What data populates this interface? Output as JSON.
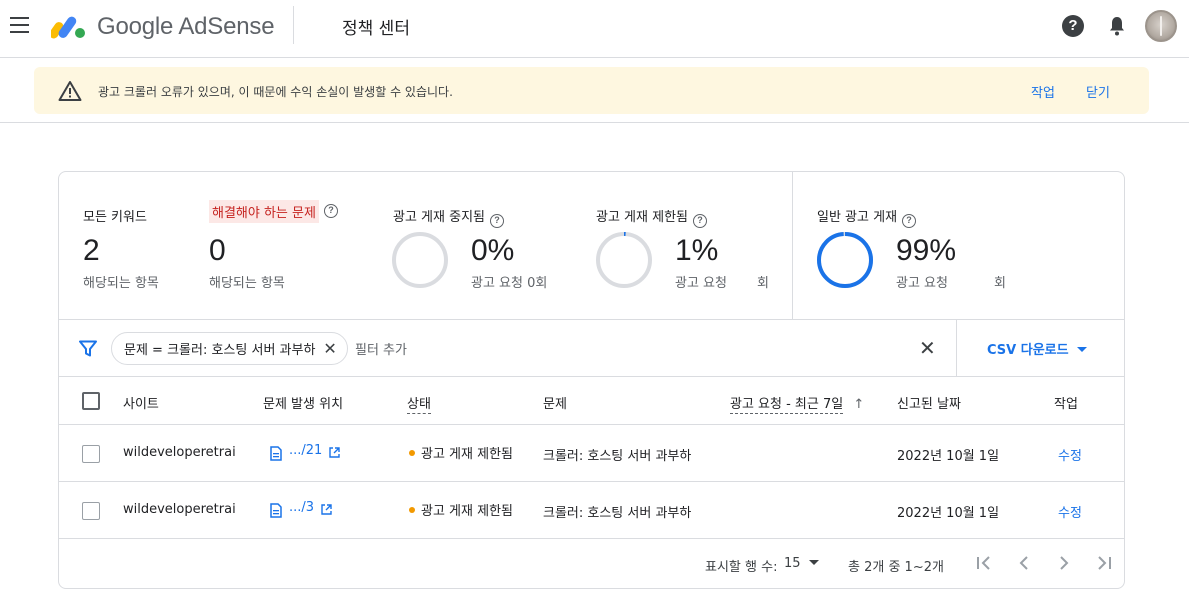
{
  "app": {
    "brand": "Google AdSense",
    "page_title": "정책 센터"
  },
  "banner": {
    "message": "광고 크롤러 오류가 있으며, 이 때문에 수익 손실이 발생할 수 있습니다.",
    "action_label": "작업",
    "dismiss_label": "닫기"
  },
  "stats": [
    {
      "label": "모든 키워드",
      "value": "2",
      "sub": "해당되는 항목"
    },
    {
      "label": "해결해야 하는 문제",
      "value": "0",
      "sub": "해당되는 항목"
    },
    {
      "label": "광고 게재 중지됨",
      "value": "0%",
      "sub": "광고 요청 0회",
      "ring_percent": 0
    },
    {
      "label": "광고 게재 제한됨",
      "value": "1%",
      "sub": "광고 요청",
      "sub_suffix": "회",
      "ring_percent": 1
    },
    {
      "label": "일반 광고 게재",
      "value": "99%",
      "sub": "광고 요청",
      "sub_suffix": "회",
      "ring_percent": 99
    }
  ],
  "filter": {
    "chip_label": "문제 = 크롤러: 호스팅 서버 과부하",
    "add_filter_placeholder": "필터 추가",
    "csv_label": "CSV 다운로드"
  },
  "table": {
    "headers": {
      "site": "사이트",
      "location": "문제 발생 위치",
      "status": "상태",
      "issue": "문제",
      "requests": "광고 요청 - 최근 7일",
      "reported": "신고된 날짜",
      "action": "작업"
    },
    "rows": [
      {
        "site": "wildeveloperetrai",
        "location": ".../21",
        "status": "광고 게재 제한됨",
        "issue": "크롤러: 호스팅 서버 과부하",
        "reported": "2022년 10월 1일",
        "action": "수정"
      },
      {
        "site": "wildeveloperetrai",
        "location": ".../3",
        "status": "광고 게재 제한됨",
        "issue": "크롤러: 호스팅 서버 과부하",
        "reported": "2022년 10월 1일",
        "action": "수정"
      }
    ]
  },
  "footer": {
    "rows_per_page_label": "표시할 행 수:",
    "rows_per_page_value": "15",
    "range_text": "총 2개 중 1~2개"
  },
  "colors": {
    "accent": "#1a73e8",
    "warning_bg": "#fef7e0",
    "status_dot": "#f29900",
    "issue_badge_bg": "#fce8e6",
    "issue_badge_text": "#c5221f"
  }
}
